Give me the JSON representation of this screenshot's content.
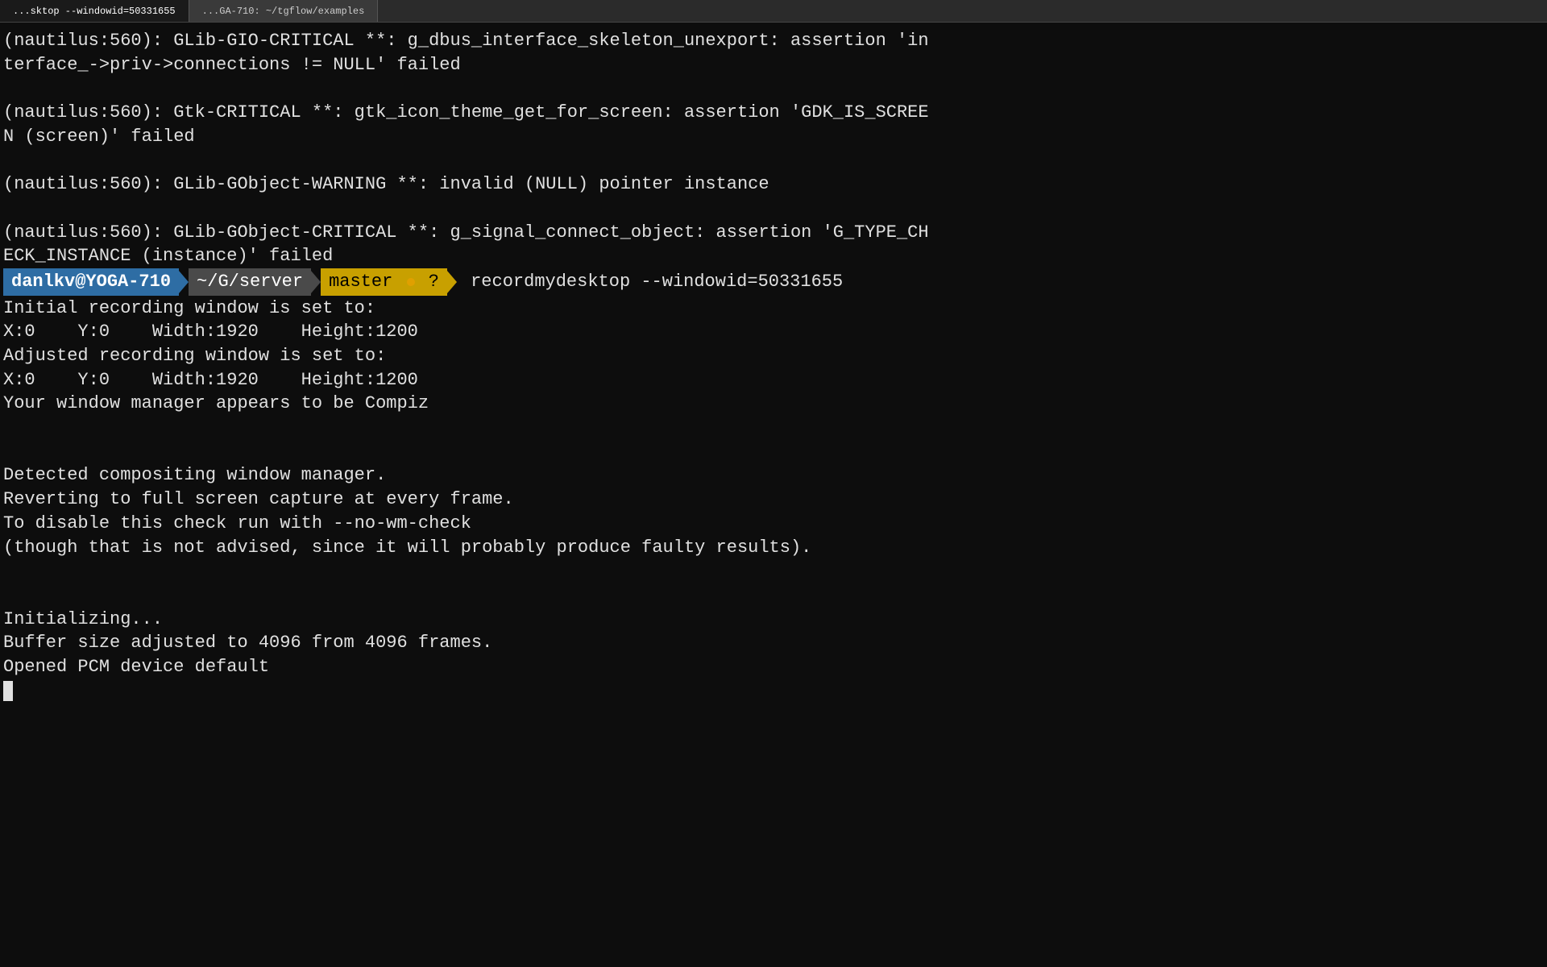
{
  "tabs": [
    {
      "id": "tab1",
      "label": "...sktop --windowid=50331655",
      "active": true
    },
    {
      "id": "tab2",
      "label": "...GA-710: ~/tgflow/examples",
      "active": false
    }
  ],
  "terminal": {
    "lines": [
      "(nautilus:560): GLib-GIO-CRITICAL **: g_dbus_interface_skeleton_unexport: assertion 'in",
      "terface_->priv->connections != NULL' failed",
      "",
      "(nautilus:560): Gtk-CRITICAL **: gtk_icon_theme_get_for_screen: assertion 'GDK_IS_SCREE",
      "N (screen)' failed",
      "",
      "(nautilus:560): GLib-GObject-WARNING **: invalid (NULL) pointer instance",
      "",
      "(nautilus:560): GLib-GObject-CRITICAL **: g_signal_connect_object: assertion 'G_TYPE_CH",
      "ECK_INSTANCE (instance)' failed"
    ],
    "prompt": {
      "user": "danlkv@YOGA-710",
      "dir": "~/G/server",
      "git_branch": "master",
      "git_dot": true,
      "git_question": "?",
      "command": "recordmydesktop --windowid=50331655"
    },
    "output_lines": [
      "Initial recording window is set to:",
      "X:0    Y:0    Width:1920    Height:1200",
      "Adjusted recording window is set to:",
      "X:0    Y:0    Width:1920    Height:1200",
      "Your window manager appears to be Compiz",
      "",
      "",
      "Detected compositing window manager.",
      "Reverting to full screen capture at every frame.",
      "To disable this check run with --no-wm-check",
      "(though that is not advised, since it will probably produce faulty results).",
      "",
      "",
      "Initializing...",
      "Buffer size adjusted to 4096 from 4096 frames.",
      "Opened PCM device default"
    ]
  }
}
